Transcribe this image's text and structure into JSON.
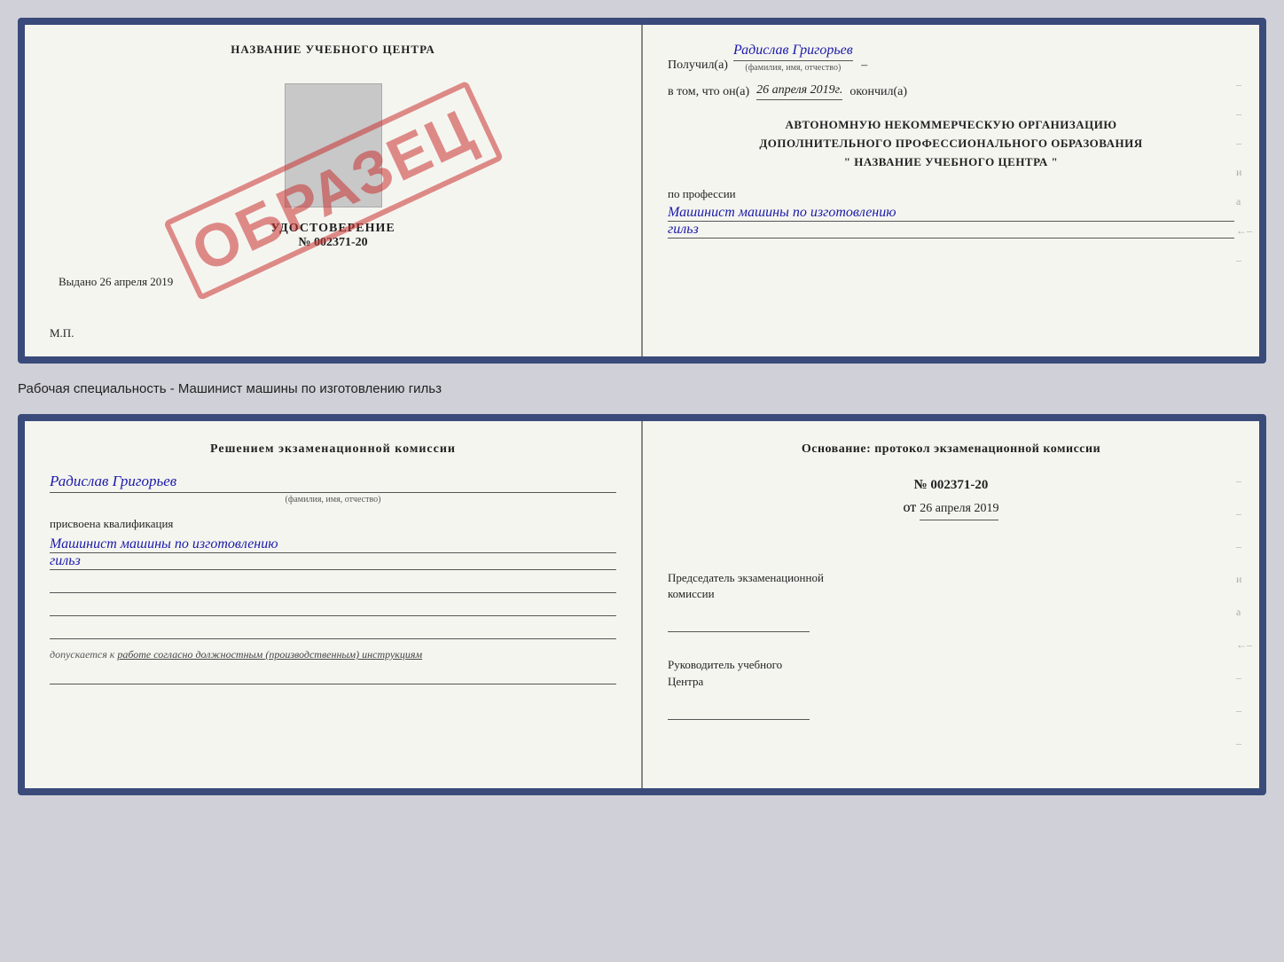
{
  "top_doc": {
    "left": {
      "school_name": "НАЗВАНИЕ УЧЕБНОГО ЦЕНТРА",
      "cert_word": "УДОСТОВЕРЕНИЕ",
      "cert_number": "№ 002371-20",
      "issued_prefix": "Выдано",
      "issued_date": "26 апреля 2019",
      "mp_label": "М.П.",
      "stamp_text": "ОБРАЗЕЦ"
    },
    "right": {
      "received_prefix": "Получил(а)",
      "received_name": "Радислав Григорьев",
      "fio_hint": "(фамилия, имя, отчество)",
      "date_prefix": "в том, что он(а)",
      "date_value": "26 апреля 2019г.",
      "finished": "окончил(а)",
      "org_line1": "АВТОНОМНУЮ НЕКОММЕРЧЕСКУЮ ОРГАНИЗАЦИЮ",
      "org_line2": "ДОПОЛНИТЕЛЬНОГО ПРОФЕССИОНАЛЬНОГО ОБРАЗОВАНИЯ",
      "org_line3": "\"   НАЗВАНИЕ УЧЕБНОГО ЦЕНТРА   \"",
      "profession_prefix": "по профессии",
      "profession_name1": "Машинист машины по изготовлению",
      "profession_name2": "гильз"
    }
  },
  "specialty_label": "Рабочая специальность - Машинист машины по изготовлению гильз",
  "bottom_doc": {
    "left": {
      "decision_title": "Решением  экзаменационной  комиссии",
      "person_name": "Радислав Григорьев",
      "fio_hint": "(фамилия, имя, отчество)",
      "qualification_prefix": "присвоена квалификация",
      "qualification_name1": "Машинист  машины  по изготовлению",
      "qualification_name2": "гильз",
      "допускается_prefix": "допускается к",
      "допускается_text": "работе согласно должностным (производственным) инструкциям"
    },
    "right": {
      "basis_title": "Основание:  протокол  экзаменационной  комиссии",
      "protocol_number": "№  002371-20",
      "date_prefix": "от",
      "date_value": "26 апреля 2019",
      "chairman_title1": "Председатель экзаменационной",
      "chairman_title2": "комиссии",
      "director_title1": "Руководитель учебного",
      "director_title2": "Центра"
    }
  }
}
